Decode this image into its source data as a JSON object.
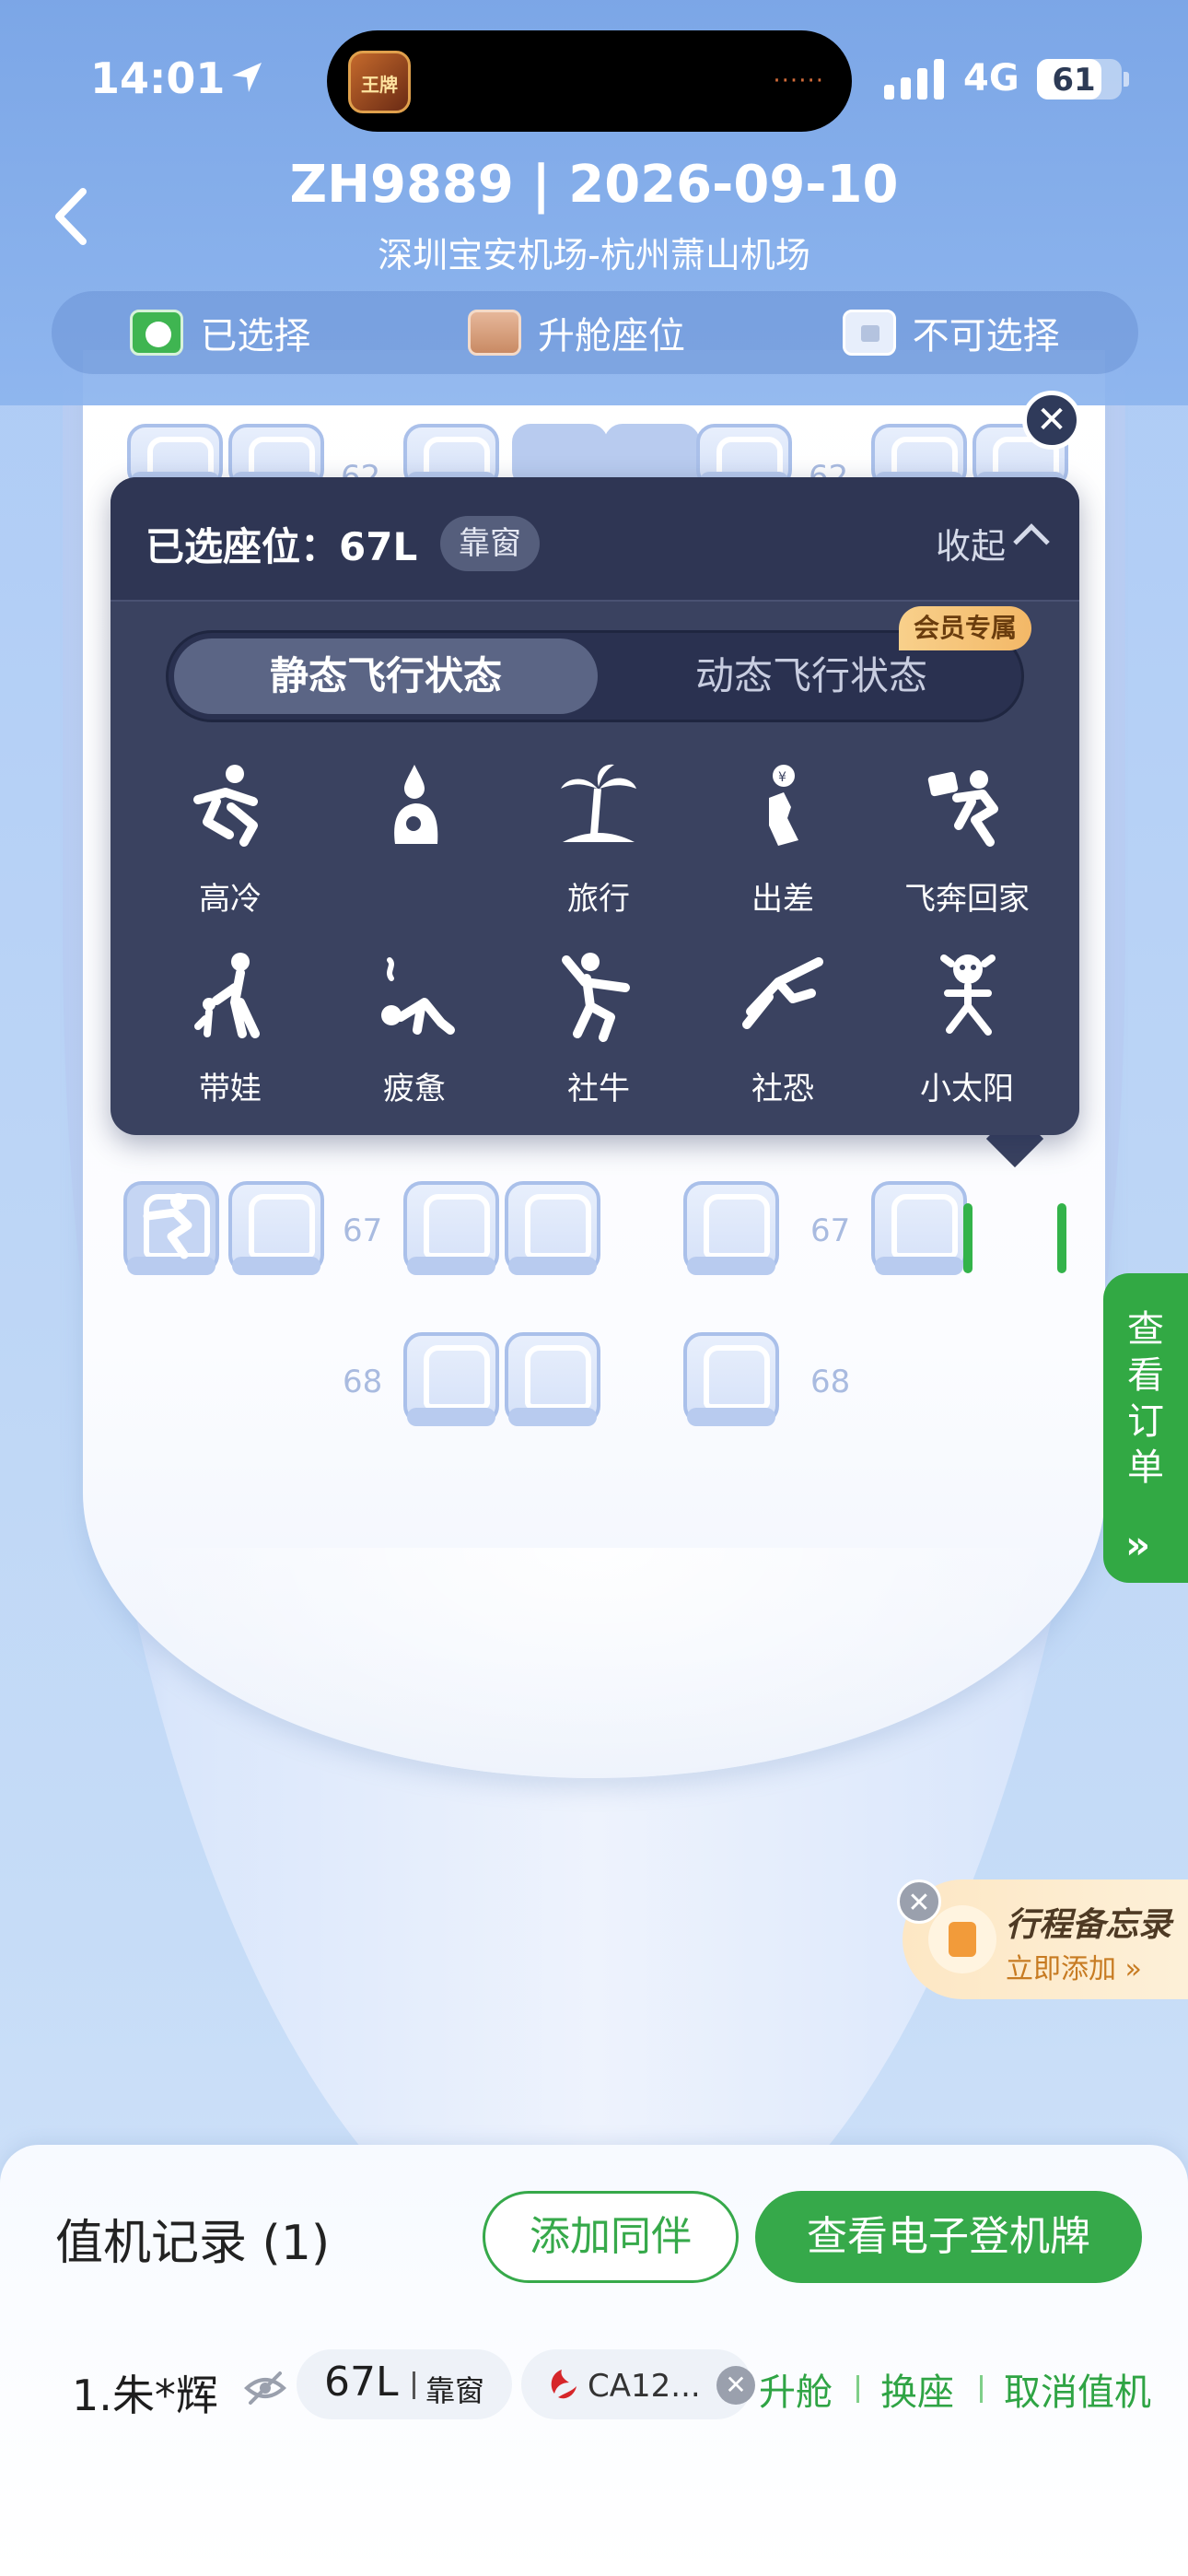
{
  "status_bar": {
    "time": "14:01",
    "network": "4G",
    "battery": "61",
    "island_app_text": "王牌"
  },
  "header": {
    "flight_title": "ZH9889 | 2026-09-10",
    "route": "深圳宝安机场-杭州萧山机场",
    "legend": [
      {
        "label": "已选择",
        "icon": "selected-seat-icon"
      },
      {
        "label": "升舱座位",
        "icon": "upgrade-seat-icon"
      },
      {
        "label": "不可选择",
        "icon": "locked-seat-icon"
      }
    ]
  },
  "seat_map": {
    "row_labels": [
      "62",
      "62",
      "67",
      "67",
      "68",
      "68"
    ]
  },
  "panel": {
    "selected_label": "已选座位：67L",
    "window_tag": "靠窗",
    "collapse_label": "收起",
    "tabs": {
      "static": "静态飞行状态",
      "dynamic": "动态飞行状态",
      "vip_badge": "会员专属"
    },
    "statuses": [
      {
        "label": "高冷",
        "icon": "aloof-person-icon"
      },
      {
        "label": "",
        "icon": "drop-person-icon"
      },
      {
        "label": "旅行",
        "icon": "palm-tree-icon"
      },
      {
        "label": "出差",
        "icon": "money-hand-icon"
      },
      {
        "label": "飞奔回家",
        "icon": "running-home-icon"
      },
      {
        "label": "带娃",
        "icon": "parent-child-icon"
      },
      {
        "label": "疲惫",
        "icon": "tired-person-icon"
      },
      {
        "label": "社牛",
        "icon": "confident-person-icon"
      },
      {
        "label": "社恐",
        "icon": "shy-person-icon"
      },
      {
        "label": "小太阳",
        "icon": "sunny-person-icon"
      }
    ]
  },
  "side_tab": {
    "label": "查看订单",
    "chevron": "»"
  },
  "memo": {
    "title": "行程备忘录",
    "subtitle": "立即添加 »"
  },
  "checkin": {
    "title": "值机记录 (1)",
    "add_companion": "添加同伴",
    "boarding_pass": "查看电子登机牌",
    "record": {
      "name": "1.朱*辉",
      "seat": "67L",
      "window": "靠窗",
      "flight": "CA12...",
      "actions": [
        "升舱",
        "换座",
        "取消值机"
      ]
    }
  },
  "colors": {
    "accent_green": "#36a94a",
    "panel_bg": "#3a4260",
    "header_blue": "#7aa5e6"
  }
}
